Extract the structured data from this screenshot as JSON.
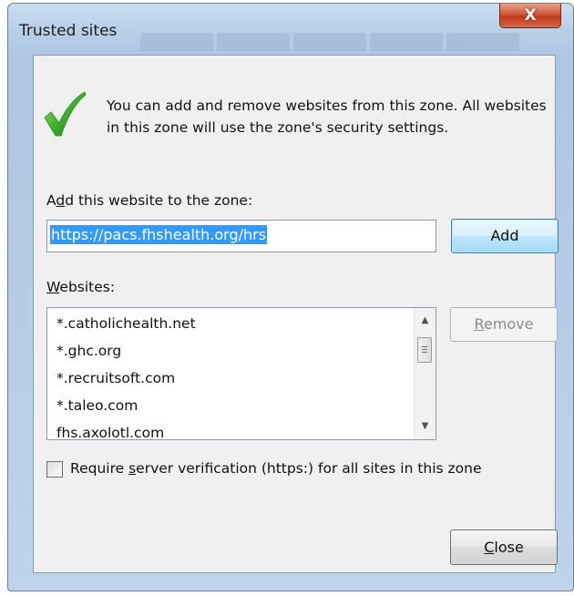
{
  "window": {
    "title": "Trusted sites",
    "close_glyph": "X"
  },
  "info": {
    "icon": "green-check-icon",
    "text": "You can add and remove websites from this zone. All websites in this zone will use the zone's security settings."
  },
  "add_section": {
    "label_mnemonic": "d",
    "label_before": "A",
    "label_after": "d this website to the zone:",
    "input_value": "https://pacs.fhshealth.org/hrs",
    "add_button": "Add"
  },
  "websites_section": {
    "label_mnemonic": "W",
    "label_rest": "ebsites:",
    "items": [
      "*.catholichealth.net",
      "*.ghc.org",
      "*.recruitsoft.com",
      "*.taleo.com",
      "fhs.axolotl.com"
    ],
    "remove_mnemonic": "R",
    "remove_rest": "emove"
  },
  "verification": {
    "checked": false,
    "label_before": "Require ",
    "label_mnemonic": "s",
    "label_after": "erver verification (https:) for all sites in this zone"
  },
  "footer": {
    "close_mnemonic": "C",
    "close_rest": "lose"
  },
  "colors": {
    "accent": "#3399ff",
    "close_button": "#c1391d"
  }
}
